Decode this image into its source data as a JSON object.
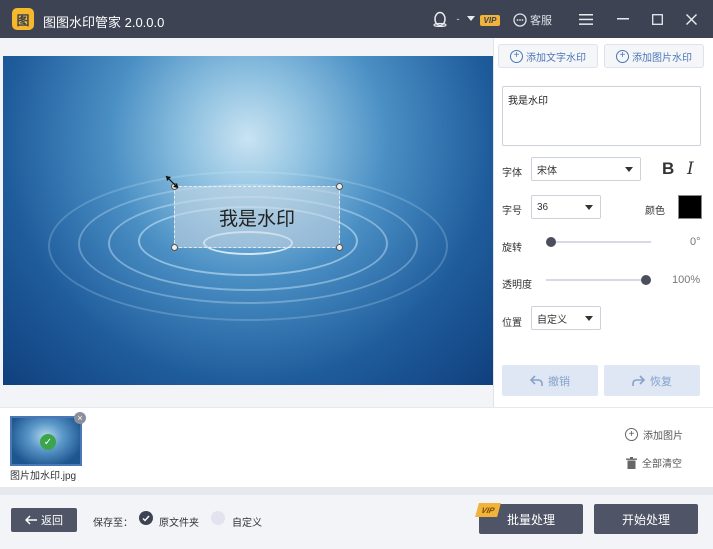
{
  "app": {
    "title": "图图水印管家  2.0.0.0",
    "logo_glyph": "图",
    "vip": "VIP",
    "service": "客服"
  },
  "titlebar": {
    "icons": [
      "penguin-icon",
      "dropdown-caret-icon",
      "chat-icon",
      "menu-icon",
      "minimize-icon",
      "maximize-icon",
      "close-icon"
    ]
  },
  "panel": {
    "tabs": [
      {
        "label": "添加文字水印"
      },
      {
        "label": "添加图片水印"
      }
    ],
    "watermark_text": "我是水印",
    "font_label": "字体",
    "font_value": "宋体",
    "size_label": "字号",
    "size_value": "36",
    "color_label": "颜色",
    "color_value": "#000000",
    "rotate_label": "旋转",
    "rotate_value": "0°",
    "opacity_label": "透明度",
    "opacity_value": "100%",
    "opacity_fraction": 1.0,
    "rotate_fraction": 0.0,
    "position_label": "位置",
    "position_value": "自定义",
    "undo_label": "撤销",
    "redo_label": "恢复"
  },
  "preview": {
    "watermark": "我是水印"
  },
  "strip": {
    "thumb_name": "图片加水印.jpg",
    "add_image": "添加图片",
    "clear_all": "全部清空"
  },
  "bottom": {
    "back": "返回",
    "save_to": "保存至：",
    "option_original": "原文件夹",
    "option_custom": "自定义",
    "batch": "批量处理",
    "start": "开始处理",
    "vip": "VIP"
  },
  "colors": {
    "titlebar": "#3d4353",
    "accent": "#4b76b8",
    "button_dark": "#4f5566",
    "vip_gold": "#f1b33a"
  }
}
